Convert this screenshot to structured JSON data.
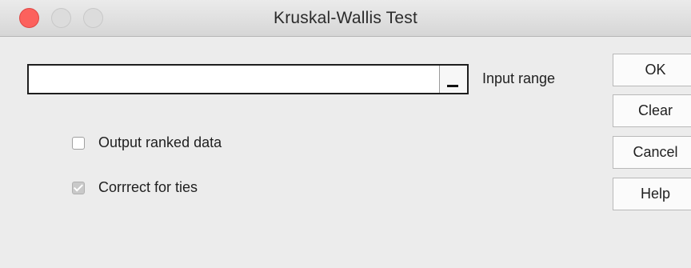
{
  "window": {
    "title": "Kruskal-Wallis Test"
  },
  "traffic_lights": {
    "close_color": "#fc615d",
    "inactive_color": "#dcdcdc"
  },
  "input_range": {
    "label": "Input range",
    "value": ""
  },
  "options": {
    "output_ranked_data": {
      "label": "Output ranked data",
      "checked": false
    },
    "correct_for_ties": {
      "label": "Corrrect for ties",
      "checked": true,
      "enabled": false
    }
  },
  "buttons": {
    "ok": "OK",
    "clear": "Clear",
    "cancel": "Cancel",
    "help": "Help"
  }
}
